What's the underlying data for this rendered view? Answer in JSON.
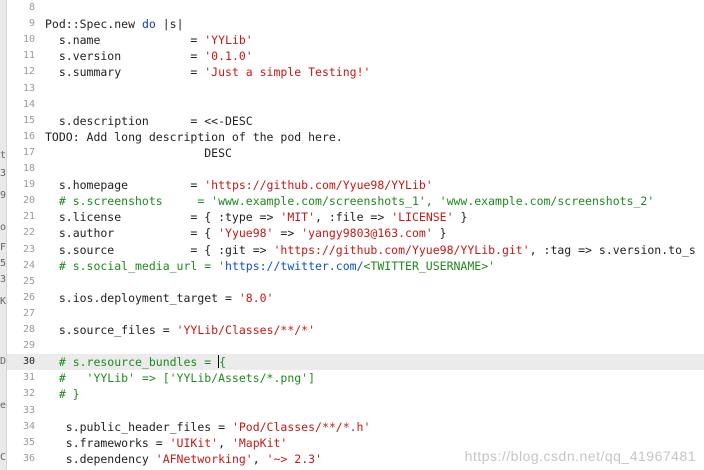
{
  "editor": {
    "lines": [
      {
        "num": "8",
        "tokens": []
      },
      {
        "num": "9",
        "tokens": [
          {
            "t": "Pod::Spec.new "
          },
          {
            "t": "do",
            "c": "kw"
          },
          {
            "t": " |s|"
          }
        ]
      },
      {
        "num": "10",
        "tokens": [
          {
            "t": "  s.name             = "
          },
          {
            "t": "'YYLib'",
            "c": "str"
          }
        ]
      },
      {
        "num": "11",
        "tokens": [
          {
            "t": "  s.version          = "
          },
          {
            "t": "'0.1.0'",
            "c": "str"
          }
        ]
      },
      {
        "num": "12",
        "tokens": [
          {
            "t": "  s.summary          = "
          },
          {
            "t": "'Just a simple Testing!'",
            "c": "str"
          }
        ]
      },
      {
        "num": "13",
        "tokens": []
      },
      {
        "num": "14",
        "tokens": []
      },
      {
        "num": "15",
        "tokens": [
          {
            "t": "  s.description      = <<-DESC"
          }
        ]
      },
      {
        "num": "16",
        "tokens": [
          {
            "t": "TODO: Add long description of the pod here."
          }
        ]
      },
      {
        "num": "17",
        "tokens": [
          {
            "t": "                       DESC"
          }
        ]
      },
      {
        "num": "18",
        "tokens": []
      },
      {
        "num": "19",
        "tokens": [
          {
            "t": "  s.homepage         = "
          },
          {
            "t": "'https://github.com/Yyue98/YYLib'",
            "c": "str"
          }
        ]
      },
      {
        "num": "20",
        "tokens": [
          {
            "t": "  # s.screenshots     = 'www.example.com/screenshots_1', 'www.example.com/screenshots_2'",
            "c": "com"
          }
        ]
      },
      {
        "num": "21",
        "tokens": [
          {
            "t": "  s.license          = { :type => "
          },
          {
            "t": "'MIT'",
            "c": "str"
          },
          {
            "t": ", :file => "
          },
          {
            "t": "'LICENSE'",
            "c": "str"
          },
          {
            "t": " }"
          }
        ]
      },
      {
        "num": "22",
        "tokens": [
          {
            "t": "  s.author           = { "
          },
          {
            "t": "'Yyue98'",
            "c": "str"
          },
          {
            "t": " => "
          },
          {
            "t": "'yangy9803@163.com'",
            "c": "str"
          },
          {
            "t": " }"
          }
        ]
      },
      {
        "num": "23",
        "tokens": [
          {
            "t": "  s.source           = { :git => "
          },
          {
            "t": "'https://github.com/Yyue98/YYLib.git'",
            "c": "str"
          },
          {
            "t": ", :tag => s.version.to_s }"
          }
        ]
      },
      {
        "num": "24",
        "tokens": [
          {
            "t": "  # s.social_media_url = '",
            "c": "com"
          },
          {
            "t": "https://twitter.com/",
            "c": "link"
          },
          {
            "t": "<TWITTER_USERNAME>'",
            "c": "com"
          }
        ]
      },
      {
        "num": "25",
        "tokens": []
      },
      {
        "num": "26",
        "tokens": [
          {
            "t": "  s.ios.deployment_target = "
          },
          {
            "t": "'8.0'",
            "c": "str"
          }
        ]
      },
      {
        "num": "27",
        "tokens": []
      },
      {
        "num": "28",
        "tokens": [
          {
            "t": "  s.source_files = "
          },
          {
            "t": "'YYLib/Classes/**/*'",
            "c": "str"
          }
        ]
      },
      {
        "num": "29",
        "tokens": []
      },
      {
        "num": "30",
        "current": true,
        "tokens": [
          {
            "t": "  # s.resource_bundles = ",
            "c": "com"
          },
          {
            "cursor": true
          },
          {
            "t": "{",
            "c": "com"
          }
        ]
      },
      {
        "num": "31",
        "tokens": [
          {
            "t": "  #   'YYLib' => ['YYLib/Assets/*.png']",
            "c": "com"
          }
        ]
      },
      {
        "num": "32",
        "tokens": [
          {
            "t": "  # }",
            "c": "com"
          }
        ]
      },
      {
        "num": "33",
        "tokens": []
      },
      {
        "num": "34",
        "tokens": [
          {
            "t": "   s.public_header_files = "
          },
          {
            "t": "'Pod/Classes/**/*.h'",
            "c": "str"
          }
        ]
      },
      {
        "num": "35",
        "tokens": [
          {
            "t": "   s.frameworks = "
          },
          {
            "t": "'UIKit'",
            "c": "str"
          },
          {
            "t": ", "
          },
          {
            "t": "'MapKit'",
            "c": "str"
          }
        ]
      },
      {
        "num": "36",
        "tokens": [
          {
            "t": "   s.dependency "
          },
          {
            "t": "'AFNetworking'",
            "c": "str"
          },
          {
            "t": ", "
          },
          {
            "t": "'~> 2.3'",
            "c": "str"
          }
        ]
      }
    ],
    "left_strip_fragments": [
      "t",
      "3",
      "9",
      "o",
      "F",
      "5",
      "3",
      "K",
      "D",
      "e",
      "C"
    ]
  },
  "watermark": "https://blog.csdn.net/qq_41967481"
}
